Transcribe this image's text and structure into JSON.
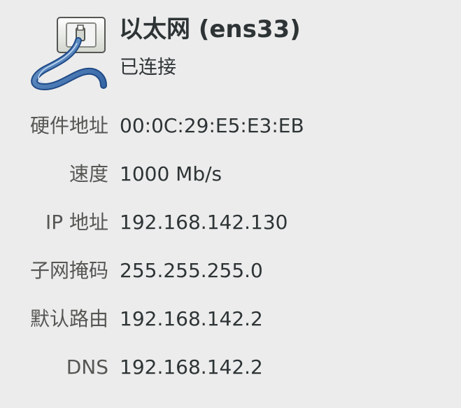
{
  "header": {
    "icon": "wired-ethernet-icon",
    "title": "以太网 (ens33)",
    "status": "已连接"
  },
  "details": [
    {
      "label": "硬件地址",
      "value": "00:0C:29:E5:E3:EB"
    },
    {
      "label": "速度",
      "value": "1000 Mb/s"
    },
    {
      "label": "IP 地址",
      "value": "192.168.142.130"
    },
    {
      "label": "子网掩码",
      "value": "255.255.255.0"
    },
    {
      "label": "默认路由",
      "value": "192.168.142.2"
    },
    {
      "label": "DNS",
      "value": "192.168.142.2"
    }
  ]
}
